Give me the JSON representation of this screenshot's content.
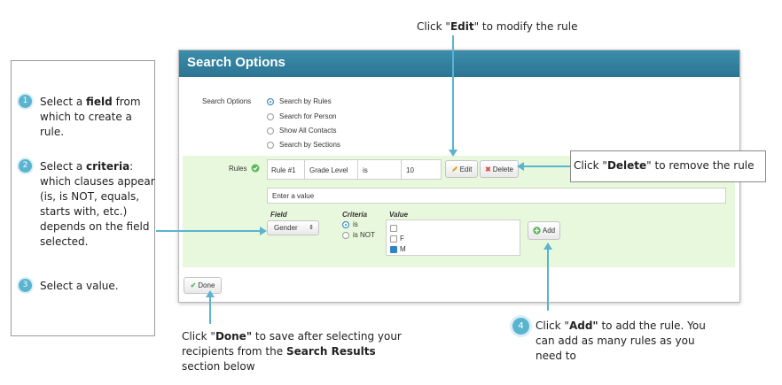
{
  "steps": [
    {
      "num": "1",
      "pre": "Select a ",
      "bold": "field",
      "post": " from which to create a rule."
    },
    {
      "num": "2",
      "pre": "Select a ",
      "bold": "criteria",
      "post": ": which clauses appear (is, is NOT, equals, starts with, etc.) depends on the field selected."
    },
    {
      "num": "3",
      "pre": "Select a value.",
      "bold": "",
      "post": ""
    }
  ],
  "callouts": {
    "edit": {
      "pre": "Click \"",
      "bold": "Edit",
      "post": "\" to modify the rule"
    },
    "delete": {
      "pre": "Click \"",
      "bold": "Delete",
      "post": "\" to remove the rule"
    },
    "done": {
      "pre": "Click \"",
      "bold": "Done\"",
      "mid": " to save after selecting your recipients from the ",
      "bold2": "Search Results",
      "post": " section below"
    },
    "add": {
      "num": "4",
      "pre": "Click \"",
      "bold": "Add\"",
      "post": " to add the rule. You can add as many rules as you need to"
    }
  },
  "panel": {
    "title": "Search Options",
    "search_options_label": "Search Options",
    "options": [
      {
        "label": "Search by Rules",
        "selected": true
      },
      {
        "label": "Search for Person",
        "selected": false
      },
      {
        "label": "Show All Contacts",
        "selected": false
      },
      {
        "label": "Search by Sections",
        "selected": false
      }
    ],
    "rules_label": "Rules",
    "rule_row": {
      "name": "Rule #1",
      "field": "Grade Level",
      "criteria": "is",
      "value": "10"
    },
    "edit_label": "Edit",
    "delete_label": "Delete",
    "value_placeholder": "Enter a value",
    "field_header": "Field",
    "criteria_header": "Criteria",
    "value_header": "Value",
    "field_select": "Gender",
    "criteria_options": [
      {
        "label": "is",
        "selected": true
      },
      {
        "label": "is NOT",
        "selected": false
      }
    ],
    "value_options": [
      {
        "label": "",
        "checked": false
      },
      {
        "label": "F",
        "checked": false
      },
      {
        "label": "M",
        "checked": true
      }
    ],
    "add_label": "Add",
    "done_label": "Done"
  },
  "colors": {
    "accent": "#5ab4d0",
    "header": "#2b7593",
    "band": "#e8f8dc",
    "delete_red": "#d9534f",
    "check_green": "#5cb85c"
  }
}
